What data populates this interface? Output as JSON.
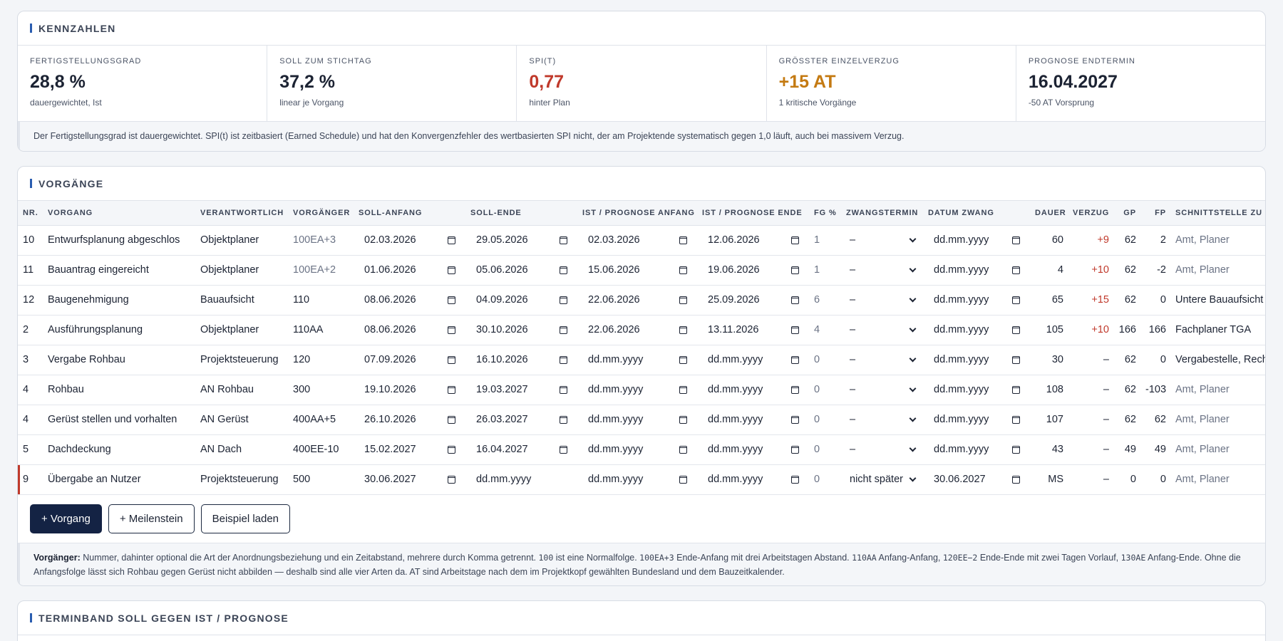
{
  "kpi": {
    "title": "KENNZAHLEN",
    "cards": [
      {
        "label": "FERTIGSTELLUNGSGRAD",
        "value": "28,8 %",
        "sub": "dauergewichtet, Ist",
        "color": "#1c2333"
      },
      {
        "label": "SOLL ZUM STICHTAG",
        "value": "37,2 %",
        "sub": "linear je Vorgang",
        "color": "#1c2333"
      },
      {
        "label": "SPI(T)",
        "value": "0,77",
        "sub": "hinter Plan",
        "color": "#c0392b"
      },
      {
        "label": "GRÖSSTER EINZELVERZUG",
        "value": "+15 AT",
        "sub": "1 kritische Vorgänge",
        "color": "#c47a12"
      },
      {
        "label": "PROGNOSE ENDTERMIN",
        "value": "16.04.2027",
        "sub": "-50 AT Vorsprung",
        "color": "#1c2333"
      }
    ],
    "note": "Der Fertigstellungsgrad ist dauergewichtet. SPI(t) ist zeitbasiert (Earned Schedule) und hat den Konvergenzfehler des wertbasierten SPI nicht, der am Projektende systematisch gegen 1,0 läuft, auch bei massivem Verzug."
  },
  "vorgaenge": {
    "title": "VORGÄNGE",
    "columns": [
      "NR.",
      "VORGANG",
      "VERANTWORTLICH",
      "VORGÄNGER",
      "SOLL-ANFANG",
      "SOLL-ENDE",
      "IST / PROGNOSE ANFANG",
      "IST / PROGNOSE ENDE",
      "FG %",
      "ZWANGSTERMIN",
      "DATUM ZWANG",
      "DAUER",
      "VERZUG",
      "GP",
      "FP",
      "SCHNITTSTELLE ZU"
    ],
    "rows": [
      {
        "nr": "10",
        "name": "Entwurfsplanung abgeschlos",
        "resp": "Objektplaner",
        "pred": "100EA+3",
        "soll_start": "02.03.2026",
        "soll_end": "29.05.2026",
        "ist_start": "02.03.2026",
        "ist_end": "12.06.2026",
        "fg": "1",
        "zwang": "–",
        "datum_zwang": "dd.mm.yyyy",
        "dauer": "60",
        "verzug": "+9",
        "gp": "62",
        "fp": "2",
        "schnitt": "Amt, Planer"
      },
      {
        "nr": "11",
        "name": "Bauantrag eingereicht",
        "resp": "Objektplaner",
        "pred": "100EA+2",
        "soll_start": "01.06.2026",
        "soll_end": "05.06.2026",
        "ist_start": "15.06.2026",
        "ist_end": "19.06.2026",
        "fg": "1",
        "zwang": "–",
        "datum_zwang": "dd.mm.yyyy",
        "dauer": "4",
        "verzug": "+10",
        "gp": "62",
        "fp": "-2",
        "schnitt": "Amt, Planer"
      },
      {
        "nr": "12",
        "name": "Baugenehmigung",
        "resp": "Bauaufsicht",
        "pred": "110",
        "soll_start": "08.06.2026",
        "soll_end": "04.09.2026",
        "ist_start": "22.06.2026",
        "ist_end": "25.09.2026",
        "fg": "6",
        "zwang": "–",
        "datum_zwang": "dd.mm.yyyy",
        "dauer": "65",
        "verzug": "+15",
        "gp": "62",
        "fp": "0",
        "schnitt": "Untere Bauaufsicht"
      },
      {
        "nr": "2",
        "name": "Ausführungsplanung",
        "resp": "Objektplaner",
        "pred": "110AA",
        "soll_start": "08.06.2026",
        "soll_end": "30.10.2026",
        "ist_start": "22.06.2026",
        "ist_end": "13.11.2026",
        "fg": "4",
        "zwang": "–",
        "datum_zwang": "dd.mm.yyyy",
        "dauer": "105",
        "verzug": "+10",
        "gp": "166",
        "fp": "166",
        "schnitt": "Fachplaner TGA"
      },
      {
        "nr": "3",
        "name": "Vergabe Rohbau",
        "resp": "Projektsteuerung",
        "pred": "120",
        "soll_start": "07.09.2026",
        "soll_end": "16.10.2026",
        "ist_start": "dd.mm.yyyy",
        "ist_end": "dd.mm.yyyy",
        "fg": "0",
        "zwang": "–",
        "datum_zwang": "dd.mm.yyyy",
        "dauer": "30",
        "verzug": "–",
        "gp": "62",
        "fp": "0",
        "schnitt": "Vergabestelle, Recht"
      },
      {
        "nr": "4",
        "name": "Rohbau",
        "resp": "AN Rohbau",
        "pred": "300",
        "soll_start": "19.10.2026",
        "soll_end": "19.03.2027",
        "ist_start": "dd.mm.yyyy",
        "ist_end": "dd.mm.yyyy",
        "fg": "0",
        "zwang": "–",
        "datum_zwang": "dd.mm.yyyy",
        "dauer": "108",
        "verzug": "–",
        "gp": "62",
        "fp": "-103",
        "schnitt": "Amt, Planer"
      },
      {
        "nr": "4",
        "name": "Gerüst stellen und vorhalten",
        "resp": "AN Gerüst",
        "pred": "400AA+5",
        "soll_start": "26.10.2026",
        "soll_end": "26.03.2027",
        "ist_start": "dd.mm.yyyy",
        "ist_end": "dd.mm.yyyy",
        "fg": "0",
        "zwang": "–",
        "datum_zwang": "dd.mm.yyyy",
        "dauer": "107",
        "verzug": "–",
        "gp": "62",
        "fp": "62",
        "schnitt": "Amt, Planer"
      },
      {
        "nr": "5",
        "name": "Dachdeckung",
        "resp": "AN Dach",
        "pred": "400EE-10",
        "soll_start": "15.02.2027",
        "soll_end": "16.04.2027",
        "ist_start": "dd.mm.yyyy",
        "ist_end": "dd.mm.yyyy",
        "fg": "0",
        "zwang": "–",
        "datum_zwang": "dd.mm.yyyy",
        "dauer": "43",
        "verzug": "–",
        "gp": "49",
        "fp": "49",
        "schnitt": "Amt, Planer"
      },
      {
        "nr": "9",
        "name": "Übergabe an Nutzer",
        "resp": "Projektsteuerung",
        "pred": "500",
        "soll_start": "30.06.2027",
        "soll_end": "dd.mm.yyyy",
        "ist_start": "dd.mm.yyyy",
        "ist_end": "dd.mm.yyyy",
        "fg": "0",
        "zwang": "nicht später",
        "datum_zwang": "30.06.2027",
        "dauer": "MS",
        "verzug": "–",
        "gp": "0",
        "fp": "0",
        "schnitt": "Amt, Planer"
      }
    ],
    "buttons": {
      "add_vorgang": "+ Vorgang",
      "add_meilenstein": "+ Meilenstein",
      "load_example": "Beispiel laden"
    },
    "note": {
      "label": "Vorgänger:",
      "t1": " Nummer, dahinter optional die Art der Anordnungsbeziehung und ein Zeitabstand, mehrere durch Komma getrennt. ",
      "c1": "100",
      "t2": " ist eine Normalfolge. ",
      "c2": "100EA+3",
      "t3": " Ende-Anfang mit drei Arbeitstagen Abstand. ",
      "c3": "110AA",
      "t4": " Anfang-Anfang, ",
      "c4": "120EE−2",
      "t5": " Ende-Ende mit zwei Tagen Vorlauf, ",
      "c5": "130AE",
      "t6": " Anfang-Ende. Ohne die Anfangsfolge lässt sich Rohbau gegen Gerüst nicht abbilden — deshalb sind alle vier Arten da. AT sind Arbeitstage nach dem im Projektkopf gewählten Bundesland und dem Bauzeitkalender."
    }
  },
  "terminband": {
    "title": "TERMINBAND SOLL GEGEN IST / PROGNOSE"
  }
}
